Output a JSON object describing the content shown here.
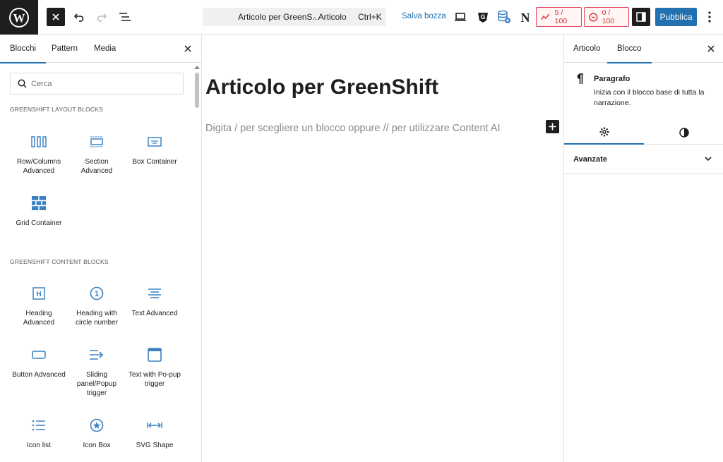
{
  "topbar": {
    "command_bar": {
      "title": "Articolo per GreenS...",
      "type": "· Articolo",
      "shortcut": "Ctrl+K"
    },
    "save_draft": "Salva bozza",
    "seo_score": "5 / 100",
    "readability_score": "0 / 100",
    "publish": "Pubblica"
  },
  "inserter": {
    "tabs": [
      "Blocchi",
      "Pattern",
      "Media"
    ],
    "active_tab": "Blocchi",
    "search_placeholder": "Cerca",
    "categories": [
      {
        "title": "GREENSHIFT LAYOUT BLOCKS",
        "blocks": [
          {
            "label": "Row/Columns Advanced",
            "icon": "columns-icon"
          },
          {
            "label": "Section Advanced",
            "icon": "section-icon"
          },
          {
            "label": "Box Container",
            "icon": "box-container-icon"
          },
          {
            "label": "Grid Container",
            "icon": "grid-icon"
          }
        ]
      },
      {
        "title": "GREENSHIFT CONTENT BLOCKS",
        "blocks": [
          {
            "label": "Heading Advanced",
            "icon": "heading-icon"
          },
          {
            "label": "Heading with circle number",
            "icon": "circle-number-icon"
          },
          {
            "label": "Text Advanced",
            "icon": "text-icon"
          },
          {
            "label": "Button Advanced",
            "icon": "button-icon"
          },
          {
            "label": "Sliding panel/Popup trigger",
            "icon": "sliding-panel-icon"
          },
          {
            "label": "Text with Po-pup trigger",
            "icon": "popup-window-icon"
          },
          {
            "label": "Icon list",
            "icon": "icon-list-icon"
          },
          {
            "label": "Icon Box",
            "icon": "icon-box-icon"
          },
          {
            "label": "SVG Shape",
            "icon": "svg-shape-icon"
          }
        ]
      }
    ]
  },
  "editor": {
    "post_title": "Articolo per GreenShift",
    "paragraph_placeholder": "Digita / per scegliere un blocco oppure // per utilizzare Content AI"
  },
  "settings": {
    "tabs": [
      "Articolo",
      "Blocco"
    ],
    "active_tab": "Blocco",
    "block_card": {
      "title": "Paragrafo",
      "description": "Inizia con il blocco base di tutta la narrazione."
    },
    "panel": "Avanzate"
  },
  "colors": {
    "accent": "#2271b1",
    "dark": "#1e1e1e",
    "score_red": "#d63638"
  }
}
